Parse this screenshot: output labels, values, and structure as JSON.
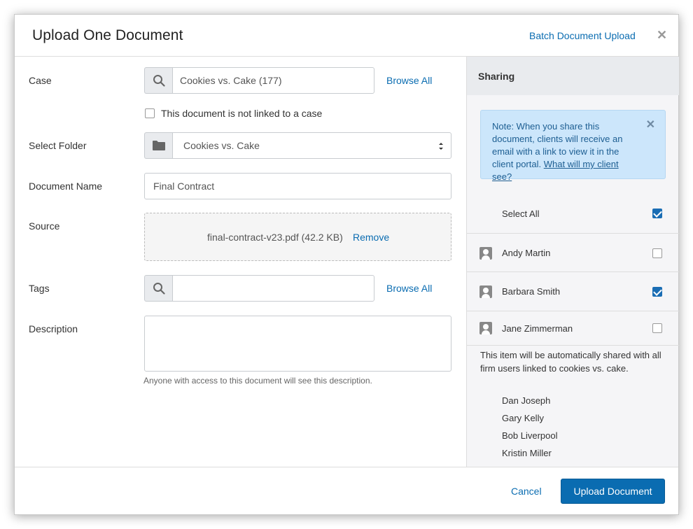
{
  "header": {
    "title": "Upload One Document",
    "batch_link": "Batch Document Upload",
    "close_icon": "close-icon"
  },
  "form": {
    "case": {
      "label": "Case",
      "value": "Cookies vs. Cake (177)",
      "browse": "Browse All",
      "icon": "search-icon"
    },
    "not_linked": {
      "label": "This document is not linked to a case",
      "checked": false
    },
    "folder": {
      "label": "Select Folder",
      "value": "Cookies vs. Cake",
      "icon": "folder-icon"
    },
    "document_name": {
      "label": "Document Name",
      "value": "Final Contract"
    },
    "source": {
      "label": "Source",
      "file": "final-contract-v23.pdf (42.2 KB)",
      "remove": "Remove"
    },
    "tags": {
      "label": "Tags",
      "value": "",
      "browse": "Browse All",
      "icon": "search-icon"
    },
    "description": {
      "label": "Description",
      "value": "",
      "hint": "Anyone with access to this document will see this description."
    }
  },
  "sharing": {
    "title": "Sharing",
    "note_text": "Note: When you share this document, clients will receive an email with a link to view it in the client portal.",
    "note_link": "What will my client see?",
    "select_all": {
      "label": "Select All",
      "checked": true
    },
    "contacts": [
      {
        "name": "Andy Martin",
        "checked": false
      },
      {
        "name": "Barbara Smith",
        "checked": true
      },
      {
        "name": "Jane Zimmerman",
        "checked": false
      }
    ],
    "auto_share_text": "This item will be automatically shared with all firm users linked to cookies vs. cake.",
    "firm_users": [
      "Dan Joseph",
      "Gary Kelly",
      "Bob Liverpool",
      "Kristin Miller"
    ]
  },
  "footer": {
    "cancel": "Cancel",
    "upload": "Upload Document"
  },
  "colors": {
    "accent": "#0a6cb1",
    "note_bg": "#cce6fb",
    "panel_bg": "#f5f5f7"
  }
}
